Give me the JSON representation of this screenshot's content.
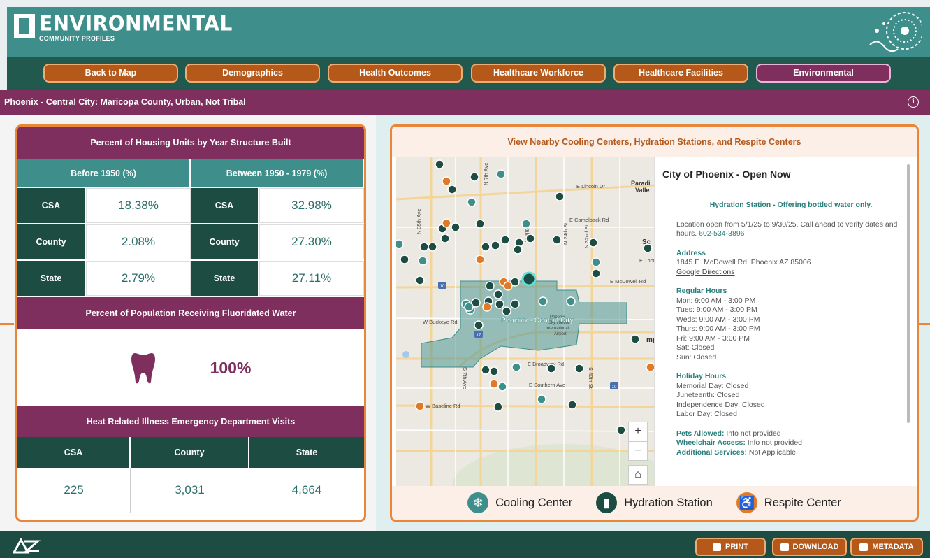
{
  "header": {
    "logo_big": "ENVIRONMENTAL",
    "logo_small": "COMMUNITY PROFILES"
  },
  "nav": [
    {
      "label": "Back to Map",
      "active": false
    },
    {
      "label": "Demographics",
      "active": false
    },
    {
      "label": "Health Outcomes",
      "active": false
    },
    {
      "label": "Healthcare Workforce",
      "active": false
    },
    {
      "label": "Healthcare Facilities",
      "active": false
    },
    {
      "label": "Environmental",
      "active": true
    }
  ],
  "region": {
    "title": "Phoenix - Central City: Maricopa County, Urban, Not Tribal",
    "info_icon": "info-icon"
  },
  "housing": {
    "title": "Percent of Housing Units by Year Structure Built",
    "col1": "Before 1950 (%)",
    "col2": "Between 1950 - 1979 (%)",
    "rows": [
      {
        "label": "CSA",
        "v1": "18.38%",
        "v2": "32.98%"
      },
      {
        "label": "County",
        "v1": "2.08%",
        "v2": "27.30%"
      },
      {
        "label": "State",
        "v1": "2.79%",
        "v2": "27.11%"
      }
    ]
  },
  "fluoride": {
    "title": "Percent of Population Receiving Fluoridated Water",
    "value": "100%",
    "icon": "tooth-icon"
  },
  "heat": {
    "title": "Heat Related Illness Emergency Department Visits",
    "headers": [
      "CSA",
      "County",
      "State"
    ],
    "values": [
      "225",
      "3,031",
      "4,664"
    ]
  },
  "map": {
    "title": "View Nearby Cooling Centers, Hydration Stations, and Respite Centers",
    "area_label": "Phoenix - Central City",
    "labels": {
      "lincoln": "E Lincoln Dr",
      "paradise1": "Paradi",
      "paradise2": "Valle",
      "camelback": "E Camelback Rd",
      "mcdowell": "E McDowell Rd",
      "thomas": "E Thor",
      "buckeye": "W Buckeye Rd",
      "broadway": "E Broadway Rd",
      "southern": "E Southern Ave",
      "baseline": "W Baseline Rd",
      "skyharbor1": "Phoenix",
      "skyharbor2": "Sky Harbor",
      "skyharbor3": "International",
      "skyharbor4": "Airport",
      "tempe": "mp",
      "sc": "Sc",
      "n7": "N 7th Ave",
      "n35": "N 35th Ave",
      "s7": "S 7th Ave",
      "s16": "S 16th St",
      "n24": "N 24th St",
      "n32": "N 32nd St",
      "s40": "S 40th St",
      "i10": "10",
      "i17": "17",
      "i10b": "10"
    },
    "zoom_in": "+",
    "zoom_out": "−",
    "home": "⌂"
  },
  "popup": {
    "title": "City of Phoenix - Open Now",
    "subtitle": "Hydration Station - Offering bottled water only.",
    "notice": "Location open from 5/1/25 to 9/30/25. Call ahead to verify dates and hours.",
    "phone": "602-534-3896",
    "address_h": "Address",
    "address": "1845 E. McDowell Rd. Phoenix AZ 85006",
    "directions": "Google Directions",
    "hours_h": "Regular Hours",
    "hours": [
      "Mon: 9:00 AM - 3:00 PM",
      "Tues: 9:00 AM - 3:00 PM",
      "Weds: 9:00 AM - 3:00 PM",
      "Thurs: 9:00 AM - 3:00 PM",
      "Fri: 9:00 AM - 3:00 PM",
      "Sat: Closed",
      "Sun: Closed"
    ],
    "holiday_h": "Holiday Hours",
    "holidays": [
      "Memorial Day: Closed",
      "Juneteenth: Closed",
      "Independence Day: Closed",
      "Labor Day: Closed"
    ],
    "pets_k": "Pets Allowed:",
    "pets_v": "Info not provided",
    "wheel_k": "Wheelchair Access:",
    "wheel_v": "Info not provided",
    "add_k": "Additional Services:",
    "add_v": "Not Applicable"
  },
  "legend": [
    {
      "label": "Cooling Center",
      "icon": "snowflake-icon",
      "color": "#3e8f8b"
    },
    {
      "label": "Hydration Station",
      "icon": "water-bottle-icon",
      "color": "#1d4c43"
    },
    {
      "label": "Respite Center",
      "icon": "wheelchair-icon",
      "color": "#e07a26"
    }
  ],
  "footer": {
    "print": "PRINT",
    "download": "DOWNLOAD",
    "metadata": "METADATA"
  },
  "colors": {
    "teal": "#3e8f8b",
    "dark_green": "#1d4c43",
    "purple": "#7e2f5e",
    "orange": "#b5591a",
    "accent_orange": "#e9863a"
  }
}
